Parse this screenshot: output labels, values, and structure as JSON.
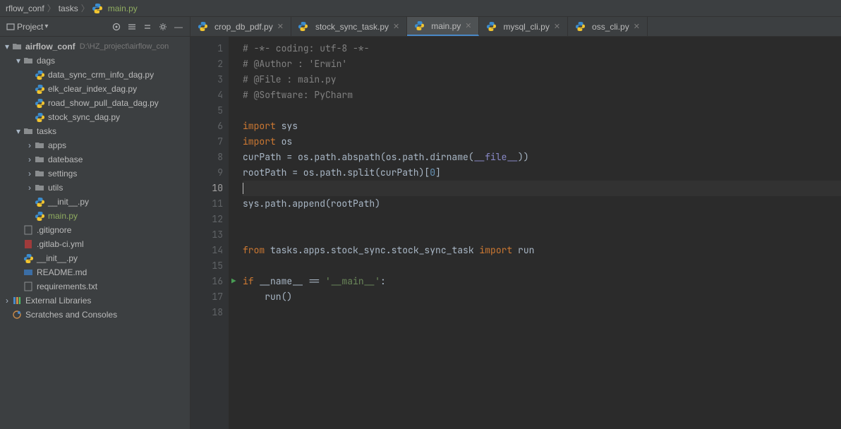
{
  "breadcrumb": {
    "root": "rflow_conf",
    "mid": "tasks",
    "file": "main.py"
  },
  "project_header": {
    "label": "Project"
  },
  "tree": {
    "root": {
      "label": "airflow_conf",
      "hint": "D:\\HZ_project\\airflow_con"
    },
    "dags": {
      "label": "dags"
    },
    "dags_files": {
      "f0": "data_sync_crm_info_dag.py",
      "f1": "elk_clear_index_dag.py",
      "f2": "road_show_pull_data_dag.py",
      "f3": "stock_sync_dag.py"
    },
    "tasks": {
      "label": "tasks"
    },
    "tasks_dirs": {
      "apps": "apps",
      "database": "datebase",
      "settings": "settings",
      "utils": "utils"
    },
    "tasks_files": {
      "init": "__init__.py",
      "main": "main.py"
    },
    "root_files": {
      "gitignore": ".gitignore",
      "gitlabci": ".gitlab-ci.yml",
      "init": "__init__.py",
      "readme": "README.md",
      "req": "requirements.txt"
    },
    "ext_libs": "External Libraries",
    "scratches": "Scratches and Consoles"
  },
  "tabs": {
    "t0": "crop_db_pdf.py",
    "t1": "stock_sync_task.py",
    "t2": "main.py",
    "t3": "mysql_cli.py",
    "t4": "oss_cli.py"
  },
  "code": {
    "l1": {
      "pre": "",
      "c": "# -*- coding: utf-8 -*-"
    },
    "l2": {
      "pre": "",
      "c": "# @Author : 'Erwin'"
    },
    "l3": {
      "pre": "",
      "c": "# @File : main.py"
    },
    "l4": {
      "pre": "",
      "c": "# @Software: PyCharm"
    },
    "l6": {
      "kw": "import ",
      "id": "sys"
    },
    "l7": {
      "kw": "import ",
      "id": "os"
    },
    "l8": {
      "a": "curPath = os.path.abspath(os.path.dirname(",
      "b": "__file__",
      "c": "))"
    },
    "l9": {
      "a": "rootPath = os.path.split(curPath)[",
      "b": "0",
      "c": "]"
    },
    "l11": {
      "a": "sys.path.append(rootPath)"
    },
    "l14": {
      "a": "from ",
      "b": "tasks.apps.stock_sync.stock_sync_task ",
      "c": "import ",
      "d": "run"
    },
    "l16": {
      "a": "if ",
      "b": "__name__ ",
      "c": "== ",
      "d": "'__main__'",
      "e": ":"
    },
    "l17": {
      "a": "    run()"
    }
  },
  "line_numbers": [
    "1",
    "2",
    "3",
    "4",
    "5",
    "6",
    "7",
    "8",
    "9",
    "10",
    "11",
    "12",
    "13",
    "14",
    "15",
    "16",
    "17",
    "18"
  ]
}
